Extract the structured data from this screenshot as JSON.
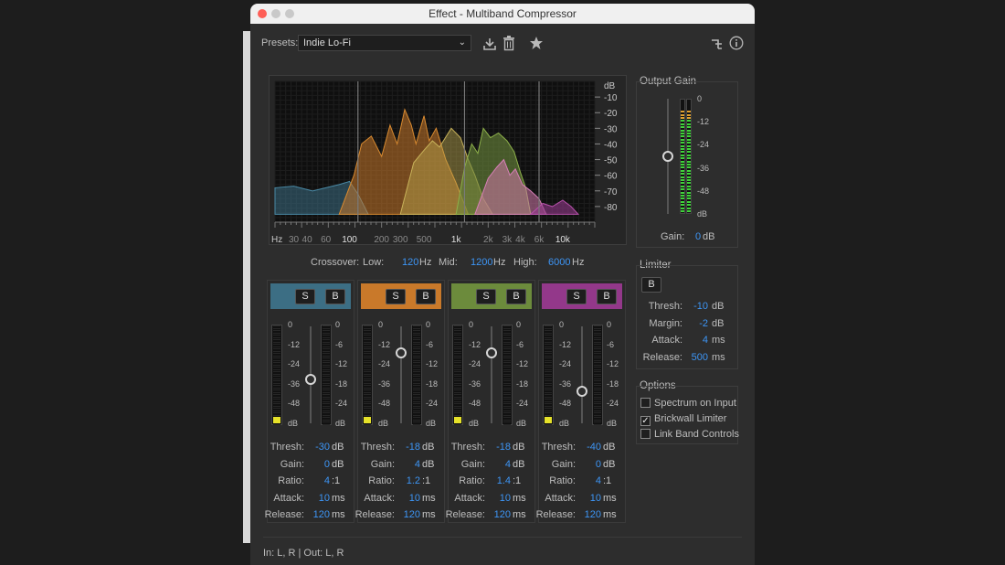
{
  "window": {
    "title": "Effect - Multiband Compressor"
  },
  "presets": {
    "label": "Presets:",
    "value": "Indie Lo-Fi"
  },
  "icons": [
    "save-preset-icon",
    "delete-preset-icon",
    "favorite-star-icon",
    "routing-icon",
    "info-icon",
    "dropdown-chevron-icon"
  ],
  "spectrum": {
    "db_label": "dB",
    "db_ticks": [
      "-10",
      "-20",
      "-30",
      "-40",
      "-50",
      "-60",
      "-70",
      "-80"
    ],
    "hz_label": "Hz",
    "hz_ticks": [
      "30",
      "40",
      "60",
      "100",
      "200",
      "300",
      "500",
      "1k",
      "2k",
      "3k",
      "4k",
      "6k",
      "10k"
    ],
    "hz_positions": [
      30,
      40,
      60,
      100,
      200,
      300,
      500,
      1000,
      2000,
      3000,
      4000,
      6000,
      10000
    ]
  },
  "crossover": {
    "label": "Crossover:",
    "low_label": "Low:",
    "low_value": "120",
    "low_unit": "Hz",
    "mid_label": "Mid:",
    "mid_value": "1200",
    "mid_unit": "Hz",
    "high_label": "High:",
    "high_value": "6000",
    "high_unit": "Hz"
  },
  "bands": [
    {
      "color": "#3c6e84",
      "solo": "S",
      "bypass": "B",
      "level_fraction": 0.06,
      "fader_fraction": 0.45,
      "meter_ticks": [
        "0",
        "-12",
        "-24",
        "-36",
        "-48",
        "dB"
      ],
      "gr_ticks": [
        "0",
        "-6",
        "-12",
        "-18",
        "-24",
        "dB"
      ],
      "params": [
        {
          "label": "Thresh:",
          "value": "-30",
          "unit": "dB"
        },
        {
          "label": "Gain:",
          "value": "0",
          "unit": "dB"
        },
        {
          "label": "Ratio:",
          "value": "4",
          "unit": ":1"
        },
        {
          "label": "Attack:",
          "value": "10",
          "unit": "ms"
        },
        {
          "label": "Release:",
          "value": "120",
          "unit": "ms"
        }
      ]
    },
    {
      "color": "#c9792a",
      "solo": "S",
      "bypass": "B",
      "level_fraction": 0.06,
      "fader_fraction": 0.73,
      "meter_ticks": [
        "0",
        "-12",
        "-24",
        "-36",
        "-48",
        "dB"
      ],
      "gr_ticks": [
        "0",
        "-6",
        "-12",
        "-18",
        "-24",
        "dB"
      ],
      "params": [
        {
          "label": "Thresh:",
          "value": "-18",
          "unit": "dB"
        },
        {
          "label": "Gain:",
          "value": "4",
          "unit": "dB"
        },
        {
          "label": "Ratio:",
          "value": "1.2",
          "unit": ":1"
        },
        {
          "label": "Attack:",
          "value": "10",
          "unit": "ms"
        },
        {
          "label": "Release:",
          "value": "120",
          "unit": "ms"
        }
      ]
    },
    {
      "color": "#6c8b3c",
      "solo": "S",
      "bypass": "B",
      "level_fraction": 0.06,
      "fader_fraction": 0.73,
      "meter_ticks": [
        "0",
        "-12",
        "-24",
        "-36",
        "-48",
        "dB"
      ],
      "gr_ticks": [
        "0",
        "-6",
        "-12",
        "-18",
        "-24",
        "dB"
      ],
      "params": [
        {
          "label": "Thresh:",
          "value": "-18",
          "unit": "dB"
        },
        {
          "label": "Gain:",
          "value": "4",
          "unit": "dB"
        },
        {
          "label": "Ratio:",
          "value": "1.4",
          "unit": ":1"
        },
        {
          "label": "Attack:",
          "value": "10",
          "unit": "ms"
        },
        {
          "label": "Release:",
          "value": "120",
          "unit": "ms"
        }
      ]
    },
    {
      "color": "#93388a",
      "solo": "S",
      "bypass": "B",
      "level_fraction": 0.06,
      "fader_fraction": 0.33,
      "meter_ticks": [
        "0",
        "-12",
        "-24",
        "-36",
        "-48",
        "dB"
      ],
      "gr_ticks": [
        "0",
        "-6",
        "-12",
        "-18",
        "-24",
        "dB"
      ],
      "params": [
        {
          "label": "Thresh:",
          "value": "-40",
          "unit": "dB"
        },
        {
          "label": "Gain:",
          "value": "0",
          "unit": "dB"
        },
        {
          "label": "Ratio:",
          "value": "4",
          "unit": ":1"
        },
        {
          "label": "Attack:",
          "value": "10",
          "unit": "ms"
        },
        {
          "label": "Release:",
          "value": "120",
          "unit": "ms"
        }
      ]
    }
  ],
  "output_gain": {
    "title": "Output Gain",
    "ticks": [
      "0",
      "-12",
      "-24",
      "-36",
      "-48",
      "dB"
    ],
    "gain_label": "Gain:",
    "gain_value": "0",
    "gain_unit": "dB",
    "meter_fraction": 0.92
  },
  "limiter": {
    "title": "Limiter",
    "bypass": "B",
    "params": [
      {
        "label": "Thresh:",
        "value": "-10",
        "unit": "dB"
      },
      {
        "label": "Margin:",
        "value": "-2",
        "unit": "dB"
      },
      {
        "label": "Attack:",
        "value": "4",
        "unit": "ms"
      },
      {
        "label": "Release:",
        "value": "500",
        "unit": "ms"
      }
    ]
  },
  "options": {
    "title": "Options",
    "items": [
      {
        "label": "Spectrum on Input",
        "checked": false
      },
      {
        "label": "Brickwall Limiter",
        "checked": true
      },
      {
        "label": "Link Band Controls",
        "checked": false
      }
    ]
  },
  "footer": {
    "io": "In: L, R | Out: L, R"
  }
}
